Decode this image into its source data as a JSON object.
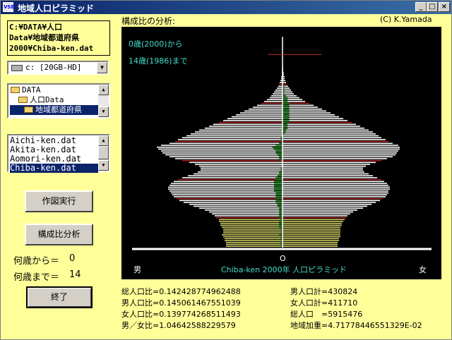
{
  "window": {
    "title": "地域人口ピラミッド",
    "app_icon": "VSE",
    "min": "_",
    "max": "□",
    "close": "×"
  },
  "header": {
    "section_title": "構成比の分析:",
    "copyright": "(C) K.Yamada"
  },
  "path": {
    "line1": "C:¥DATA¥人口",
    "line2": "Data¥地域都道府県",
    "line3": "2000¥Chiba-ken.dat"
  },
  "drive": {
    "value": "c: [20GB-HD]"
  },
  "dirs": [
    {
      "label": "DATA",
      "indent": 0,
      "selected": false
    },
    {
      "label": "人口Data",
      "indent": 1,
      "selected": false
    },
    {
      "label": "地域都道府県",
      "indent": 2,
      "selected": true
    }
  ],
  "files": [
    {
      "label": "Aichi-ken.dat",
      "selected": false
    },
    {
      "label": "Akita-ken.dat",
      "selected": false
    },
    {
      "label": "Aomori-ken.dat",
      "selected": false
    },
    {
      "label": "Chiba-ken.dat",
      "selected": true
    }
  ],
  "buttons": {
    "draw": "作図実行",
    "analyze": "構成比分析",
    "exit": "終了"
  },
  "age_from": {
    "label": "何歳から＝",
    "value": "0"
  },
  "age_to": {
    "label": "何歳まで＝",
    "value": "14"
  },
  "plot": {
    "annot_from": "0歳(2000)から",
    "annot_to": "14歳(1986)まで",
    "zero_label": "O",
    "male_label": "男",
    "female_label": "女",
    "caption": "Chiba-ken 2000年  人口ピラミッド"
  },
  "stats": {
    "total_ratio": "総人口比=0.142428774962488",
    "male_ratio": "男人口比=0.145061467551039",
    "female_ratio": "女人口比=0.139774268511493",
    "mf_ratio": "男／女比=1.04642588229579",
    "male_total": "男人口計=430824",
    "female_total": "女人口計=411710",
    "total_pop": "総人口　=5915476",
    "weight": "地域加重=4.71778446551329E-02"
  },
  "chart_data": {
    "type": "bar",
    "orientation": "horizontal-pyramid",
    "age_range": [
      0,
      100
    ],
    "highlight_range": [
      0,
      14
    ],
    "colors": {
      "bar": "#ffffff",
      "highlight": "#cccc66",
      "tick": "#aa2222",
      "diff": "#228822",
      "axis": "#ffffff",
      "top_marker": "#c0392b",
      "center": "#ffffff"
    },
    "male_widths": [
      80,
      80,
      80,
      82,
      82,
      84,
      86,
      84,
      84,
      84,
      86,
      88,
      88,
      90,
      90,
      94,
      96,
      100,
      104,
      110,
      118,
      126,
      132,
      140,
      146,
      150,
      154,
      156,
      158,
      160,
      162,
      162,
      160,
      158,
      154,
      148,
      142,
      134,
      126,
      120,
      116,
      116,
      118,
      124,
      132,
      142,
      152,
      160,
      166,
      170,
      172,
      176,
      178,
      172,
      160,
      152,
      148,
      142,
      136,
      130,
      124,
      118,
      110,
      104,
      98,
      90,
      84,
      78,
      72,
      66,
      60,
      54,
      48,
      42,
      36,
      30,
      26,
      22,
      18,
      16,
      14,
      12,
      10,
      8,
      6,
      5,
      4,
      3,
      2,
      2,
      1,
      1,
      1,
      1,
      0,
      0,
      0,
      0,
      0,
      0,
      0
    ],
    "female_widths": [
      78,
      78,
      78,
      80,
      80,
      82,
      82,
      82,
      82,
      82,
      82,
      84,
      84,
      86,
      88,
      90,
      92,
      96,
      100,
      106,
      114,
      120,
      126,
      132,
      138,
      142,
      146,
      148,
      150,
      150,
      152,
      152,
      150,
      148,
      144,
      140,
      134,
      128,
      122,
      116,
      114,
      114,
      118,
      124,
      132,
      140,
      148,
      156,
      160,
      162,
      164,
      166,
      166,
      164,
      156,
      150,
      146,
      140,
      136,
      132,
      128,
      122,
      116,
      110,
      104,
      98,
      92,
      86,
      80,
      74,
      68,
      62,
      56,
      50,
      44,
      38,
      32,
      28,
      24,
      20,
      16,
      14,
      12,
      10,
      8,
      6,
      5,
      4,
      3,
      3,
      2,
      2,
      1,
      1,
      1,
      1,
      0,
      0,
      0,
      0,
      0
    ]
  }
}
